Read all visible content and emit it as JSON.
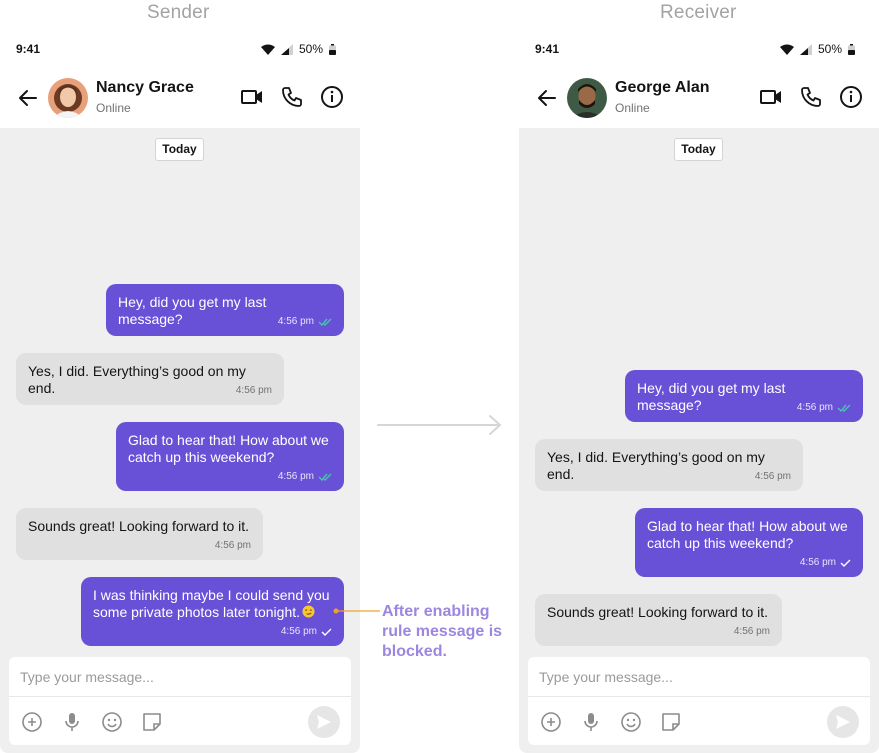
{
  "colors": {
    "accent": "#6851d6",
    "incoming_bubble": "#e0e0e0",
    "chat_background": "#efefef",
    "read_receipt": "#45c4b0",
    "annotation": "#9b87e0",
    "label_gray": "#a3a3a3"
  },
  "sender": {
    "panel_title": "Sender",
    "status_bar": {
      "time": "9:41",
      "battery": "50%"
    },
    "header": {
      "name": "Nancy Grace",
      "status": "Online",
      "icons": [
        "back-arrow-icon",
        "video-call-icon",
        "phone-icon",
        "info-icon"
      ]
    },
    "date_separator": "Today",
    "messages": [
      {
        "direction": "outgoing",
        "text": "Hey, did you get my last message?",
        "time": "4:56 pm",
        "receipt": "read"
      },
      {
        "direction": "incoming",
        "text": "Yes, I did. Everything’s good on my end.",
        "time": "4:56 pm"
      },
      {
        "direction": "outgoing",
        "text": "Glad to hear that! How about we catch up this weekend?",
        "time": "4:56 pm",
        "receipt": "read"
      },
      {
        "direction": "incoming",
        "text": "Sounds great! Looking forward to it.",
        "time": "4:56 pm"
      },
      {
        "direction": "outgoing",
        "text": "I was thinking maybe I could send you some private photos later tonight.",
        "emoji": "smirk-emoji",
        "time": "4:56 pm",
        "receipt": "sent"
      }
    ],
    "composer": {
      "placeholder": "Type your message...",
      "icons": [
        "add-icon",
        "microphone-icon",
        "emoji-icon",
        "sticker-icon",
        "send-icon"
      ]
    }
  },
  "receiver": {
    "panel_title": "Receiver",
    "status_bar": {
      "time": "9:41",
      "battery": "50%"
    },
    "header": {
      "name": "George Alan",
      "status": "Online",
      "icons": [
        "back-arrow-icon",
        "video-call-icon",
        "phone-icon",
        "info-icon"
      ]
    },
    "date_separator": "Today",
    "messages": [
      {
        "direction": "outgoing",
        "text": "Hey, did you get my last message?",
        "time": "4:56 pm",
        "receipt": "read"
      },
      {
        "direction": "incoming",
        "text": "Yes, I did. Everything’s good on my end.",
        "time": "4:56 pm"
      },
      {
        "direction": "outgoing",
        "text": "Glad to hear that! How about we catch up this weekend?",
        "time": "4:56 pm",
        "receipt": "sent"
      },
      {
        "direction": "incoming",
        "text": "Sounds great! Looking forward to it.",
        "time": "4:56 pm"
      }
    ],
    "composer": {
      "placeholder": "Type your message...",
      "icons": [
        "add-icon",
        "microphone-icon",
        "emoji-icon",
        "sticker-icon",
        "send-icon"
      ]
    }
  },
  "annotation": {
    "text": "After enabling rule message is blocked."
  }
}
